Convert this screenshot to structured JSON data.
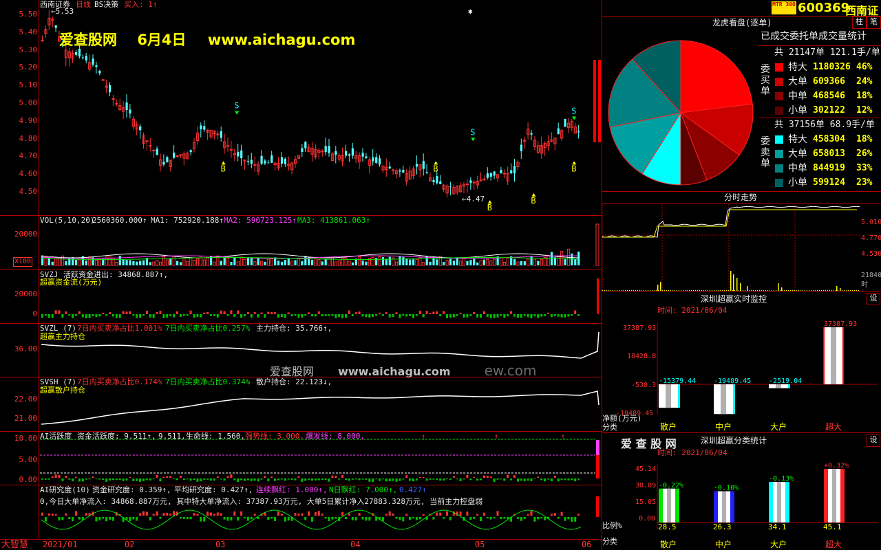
{
  "stock": {
    "code": "600369",
    "name": "西南证",
    "logo_text": "MTR 300"
  },
  "main_chart": {
    "title": "西南证券",
    "period": "日线",
    "indicator": "BS决策",
    "buy_label": "买入: 1↑",
    "watermark_site": "爱查股网",
    "watermark_date": "6月4日",
    "watermark_url": "www.aichagu.com",
    "high_mark": "5.53",
    "low_mark": "4.47",
    "yaxis": [
      "5.50",
      "5.40",
      "5.30",
      "5.20",
      "5.10",
      "5.00",
      "4.90",
      "4.80",
      "4.70",
      "4.60",
      "4.50"
    ]
  },
  "vol_panel": {
    "label": "VOL(5,10,20)",
    "value": "2560360.000↑",
    "ma1": "MA1: 752920.188↑",
    "ma2": "MA2: 590723.125↑",
    "ma3": "MA3: 413861.063↑",
    "yaxis": [
      "20000"
    ],
    "unit": "X100"
  },
  "svzj_panel": {
    "label": "SVZJ",
    "text": "活跃资金进出: 34868.887↑,",
    "sub": "超赢资金流(万元)",
    "yaxis": [
      "20000",
      "0"
    ]
  },
  "svzl_panel": {
    "label": "SVZL (7)",
    "a": "7日内买卖净占比1.001%",
    "b": "7日内买卖净占比0.257%",
    "c": "主力持仓: 35.766↑,",
    "sub": "超赢主力持仓",
    "yaxis": [
      "36.00"
    ],
    "wm_site": "爱查股网",
    "wm_url": "www.aichagu.com",
    "wm_ghost": "ew.com"
  },
  "svsh_panel": {
    "label": "SVSH (7)",
    "a": "7日内买卖净占比0.174%",
    "b": "7日内买卖净占比0.374%",
    "c": "散户持仓: 22.123↓,",
    "sub": "超赢散户持仓",
    "yaxis": [
      "22.00",
      "21.00"
    ]
  },
  "ai_active": {
    "label": "AI活跃度",
    "a": "资金活跃度: 9.511↑,",
    "b": "9.511,",
    "c": "生命线: 1.560,",
    "d": "强势线: 3.000,",
    "e": "爆发线: 8.000,",
    "yaxis": [
      "10.00",
      "5.00",
      "0.00"
    ]
  },
  "ai_research": {
    "label": "AI研究度(10)",
    "a": "资金研究度: 0.359↑,",
    "b": "平均研究度: 0.427↑,",
    "c": "连续飘红: 1.000↑,",
    "d": "N日飘红: 7.000↑,",
    "e": "0.427↑",
    "line2": "0,今日大单净流入: 34868.887万元, 其中特大单净流入: 37387.93万元, 大单5日累计净入27883.328万元, 当前主力控盘弱"
  },
  "xaxis": {
    "brand": "大智慧",
    "labels": [
      "2021/01",
      "02",
      "03",
      "04",
      "05",
      "06"
    ]
  },
  "dragon": {
    "title": "龙虎看盘(逐单)",
    "subtitle": "已成交委托单成交量统计",
    "buy": {
      "side": "委买单",
      "total": "共 21147单 121.1手/单",
      "rows": [
        {
          "name": "特大",
          "vol": "1180326",
          "pct": "46%",
          "color": "#ff0000"
        },
        {
          "name": "大单",
          "vol": "609366",
          "pct": "24%",
          "color": "#c80000"
        },
        {
          "name": "中单",
          "vol": "468546",
          "pct": "18%",
          "color": "#8c0000"
        },
        {
          "name": "小单",
          "vol": "302122",
          "pct": "12%",
          "color": "#5a0000"
        }
      ]
    },
    "sell": {
      "side": "委卖单",
      "total": "共 37156单 68.9手/单",
      "rows": [
        {
          "name": "特大",
          "vol": "458304",
          "pct": "18%",
          "color": "#00ffff"
        },
        {
          "name": "大单",
          "vol": "658013",
          "pct": "26%",
          "color": "#00a0a0"
        },
        {
          "name": "中单",
          "vol": "844919",
          "pct": "33%",
          "color": "#008080"
        },
        {
          "name": "小单",
          "vol": "599124",
          "pct": "23%",
          "color": "#006060"
        }
      ]
    },
    "btn_a": "柱",
    "btn_b": "笔"
  },
  "intraday": {
    "title": "分时走势",
    "yaxis": [
      "5.010",
      "4.770",
      "4.530"
    ],
    "vol_label": "21840",
    "unit": "时"
  },
  "realtime": {
    "title": "深圳超赢实时监控",
    "set": "设",
    "time": "时间: 2021/06/04",
    "unit": "净额(万元)",
    "cat_label": "分类",
    "yaxis": [
      "37387.93",
      "18428.8",
      "-530.3",
      "-19489.45"
    ],
    "bars": [
      {
        "name": "散户",
        "value": -15379.44,
        "label": "-15379.44"
      },
      {
        "name": "中户",
        "value": -19489.45,
        "label": "-19489.45"
      },
      {
        "name": "大户",
        "value": -2519.04,
        "label": "-2519.04"
      },
      {
        "name": "超大",
        "value": 37387.93,
        "label": "37387.93"
      }
    ]
  },
  "category": {
    "brand": "爱 查 股 网",
    "title": "深圳超赢分类统计",
    "set": "设",
    "time": "时间: 2021/06/04",
    "unit": "比例%",
    "cat_label": "分类",
    "yaxis": [
      "45.14",
      "30.09",
      "15.05",
      "0.00"
    ],
    "bars": [
      {
        "name": "散户",
        "value": 28.5,
        "change": "-0.22%",
        "color": "#00e600"
      },
      {
        "name": "中户",
        "value": 26.3,
        "change": "-0.10%",
        "color": "#2020ff"
      },
      {
        "name": "大户",
        "value": 34.1,
        "change": "-0.13%",
        "color": "#00ffff"
      },
      {
        "name": "超大",
        "value": 45.1,
        "change": "+0.32%",
        "color": "#ff2020"
      }
    ],
    "bottom": [
      "28.5",
      "26.3",
      "34.1",
      "45.1"
    ]
  }
}
